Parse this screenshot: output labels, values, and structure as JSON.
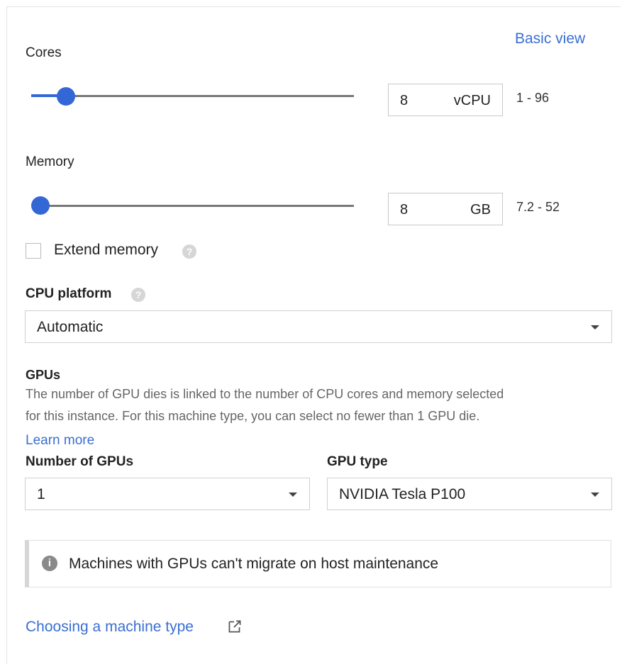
{
  "header": {
    "basic_view_link": "Basic view"
  },
  "cores": {
    "label": "Cores",
    "value": "8",
    "unit": "vCPU",
    "range": "1 - 96",
    "slider_fraction": 0.08
  },
  "memory": {
    "label": "Memory",
    "value": "8",
    "unit": "GB",
    "range": "7.2 - 52",
    "slider_fraction": 0.0
  },
  "extend_memory": {
    "label": "Extend memory",
    "checked": false,
    "help_icon": "question-circle-icon"
  },
  "cpu_platform": {
    "label": "CPU platform",
    "selected": "Automatic",
    "help_icon": "question-circle-icon"
  },
  "gpus": {
    "heading": "GPUs",
    "description_line1": "The number of GPU dies is linked to the number of CPU cores and memory selected",
    "description_line2": "for this instance. For this machine type, you can select no fewer than 1 GPU die.",
    "learn_more": "Learn more",
    "number_label": "Number of GPUs",
    "number_selected": "1",
    "type_label": "GPU type",
    "type_selected": "NVIDIA Tesla P100"
  },
  "notice": {
    "text": "Machines with GPUs can't migrate on host maintenance",
    "icon": "info-icon"
  },
  "footer": {
    "machine_type_link": "Choosing a machine type",
    "link_icon": "external-link-icon"
  },
  "colors": {
    "accent": "#3367d6",
    "link": "#3a6fd1"
  }
}
